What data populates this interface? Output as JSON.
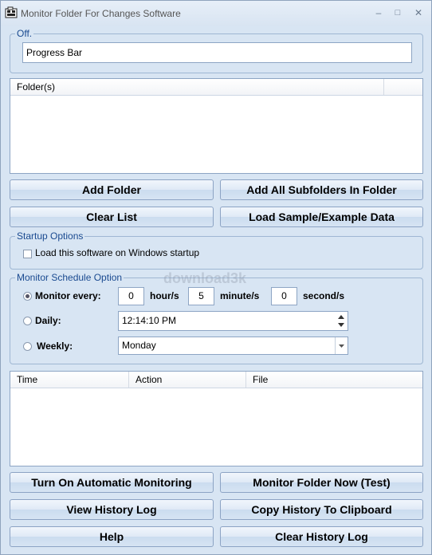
{
  "window": {
    "title": "Monitor Folder For Changes Software",
    "minimize": "–",
    "maximize": "□",
    "close": "✕"
  },
  "status_group": {
    "label": "Off.",
    "progress_text": "Progress Bar"
  },
  "folders": {
    "columns": [
      "Folder(s)"
    ]
  },
  "buttons": {
    "add_folder": "Add Folder",
    "add_subfolders": "Add All Subfolders In Folder",
    "clear_list": "Clear List",
    "load_sample": "Load Sample/Example Data",
    "turn_on_monitoring": "Turn On Automatic Monitoring",
    "monitor_now": "Monitor Folder Now (Test)",
    "view_history": "View History Log",
    "copy_history": "Copy History To Clipboard",
    "help": "Help",
    "clear_history": "Clear History Log"
  },
  "startup": {
    "label": "Startup Options",
    "checkbox_label": "Load this software on Windows startup",
    "checked": false
  },
  "schedule": {
    "label": "Monitor Schedule Option",
    "monitor_every_label": "Monitor every:",
    "hours": "0",
    "hours_unit": "hour/s",
    "minutes": "5",
    "minutes_unit": "minute/s",
    "seconds": "0",
    "seconds_unit": "second/s",
    "daily_label": "Daily:",
    "daily_time": "12:14:10 PM",
    "weekly_label": "Weekly:",
    "weekly_day": "Monday",
    "selected": "monitor_every"
  },
  "history": {
    "columns": [
      "Time",
      "Action",
      "File"
    ]
  },
  "watermark": "download3k"
}
